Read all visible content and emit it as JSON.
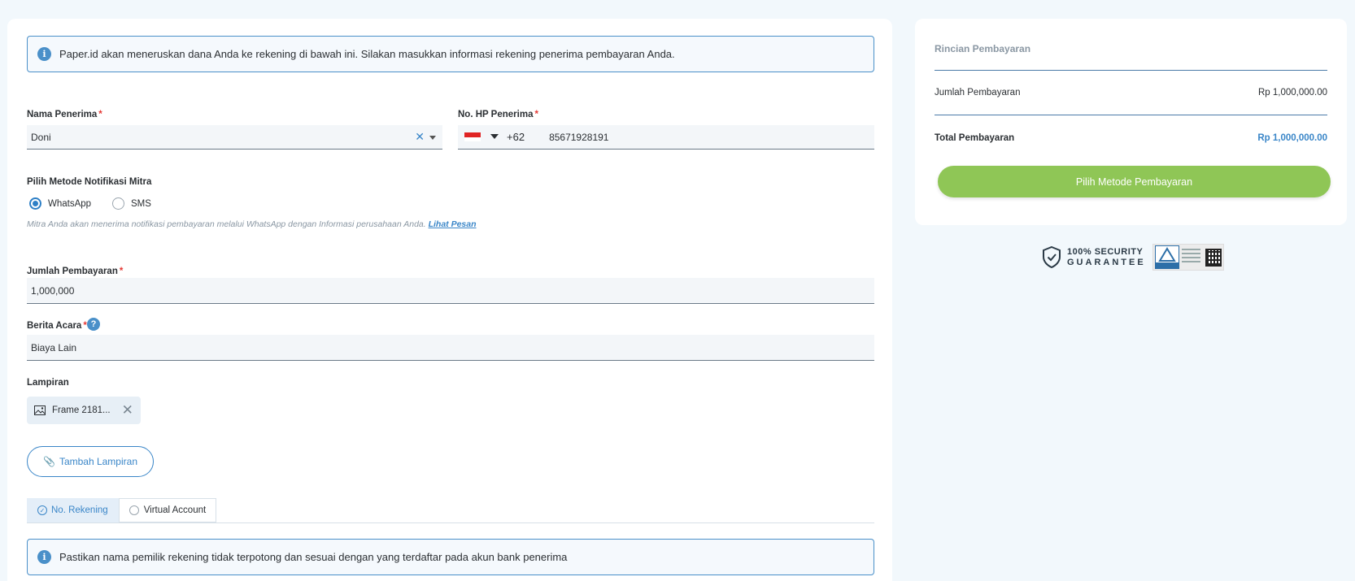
{
  "info_top": "Paper.id akan meneruskan dana Anda ke rekening di bawah ini. Silakan masukkan informasi rekening penerima pembayaran Anda.",
  "recipient": {
    "label": "Nama Penerima",
    "value": "Doni"
  },
  "phone": {
    "label": "No. HP Penerima",
    "country_code": "+62",
    "value": "85671928191"
  },
  "notification": {
    "label": "Pilih Metode Notifikasi Mitra",
    "options": [
      "WhatsApp",
      "SMS"
    ],
    "selected": "WhatsApp",
    "hint": "Mitra Anda akan menerima notifikasi pembayaran melalui WhatsApp dengan Informasi perusahaan Anda.",
    "hint_link": "Lihat Pesan"
  },
  "amount": {
    "label": "Jumlah Pembayaran",
    "value": "1,000,000"
  },
  "memo": {
    "label": "Berita Acara",
    "value": "Biaya Lain"
  },
  "attachment": {
    "label": "Lampiran",
    "file_name": "Frame 2181...",
    "add_label": "Tambah Lampiran"
  },
  "account_tabs": [
    "No. Rekening",
    "Virtual Account"
  ],
  "info_bottom": "Pastikan nama pemilik rekening tidak terpotong dan sesuai dengan yang terdaftar pada akun bank penerima",
  "summary": {
    "title": "Rincian Pembayaran",
    "amount_label": "Jumlah Pembayaran",
    "amount_value": "Rp 1,000,000.00",
    "total_label": "Total Pembayaran",
    "total_value": "Rp 1,000,000.00",
    "pay_button": "Pilih Metode Pembayaran"
  },
  "security": {
    "line1": "100% SECURITY",
    "line2": "GUARANTEE"
  },
  "colors": {
    "accent": "#3a86c8",
    "pay_button": "#8fc656",
    "required": "#e53935"
  }
}
